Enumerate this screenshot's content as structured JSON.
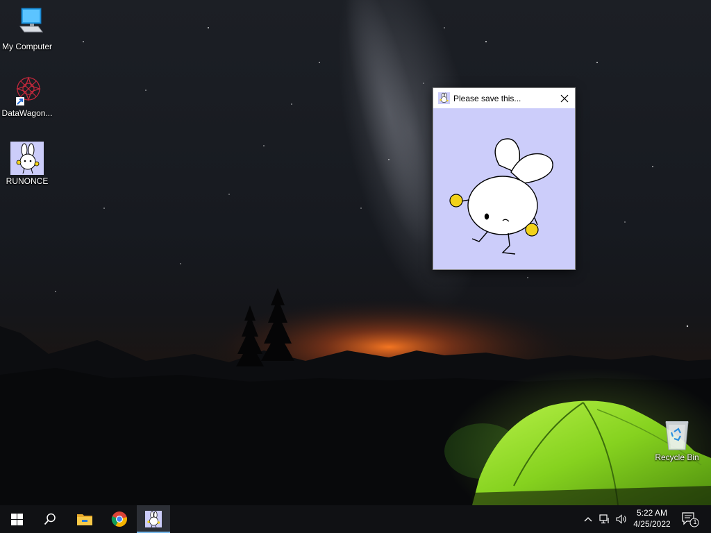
{
  "desktop": {
    "icons": [
      {
        "label": "My Computer",
        "icon": "computer-icon"
      },
      {
        "label": "DataWagon...",
        "icon": "datawagon-icon"
      },
      {
        "label": "RUNONCE",
        "icon": "bunny-icon"
      },
      {
        "label": "Recycle Bin",
        "icon": "recycle-bin-icon"
      }
    ]
  },
  "dialog": {
    "title": "Please save this...",
    "icon": "bunny-icon",
    "background": "#cccdfa"
  },
  "taskbar": {
    "start_icon": "windows-logo-icon",
    "search_icon": "search-icon",
    "pinned": [
      "file-explorer-icon",
      "chrome-icon",
      "bunny-icon"
    ],
    "active_app": "bunny-icon",
    "accent": "#76b9ed",
    "tray": {
      "icons": [
        "chevron-up-icon",
        "network-icon",
        "volume-icon"
      ],
      "time": "5:22 AM",
      "date": "4/25/2022",
      "notification_count": "1"
    }
  }
}
